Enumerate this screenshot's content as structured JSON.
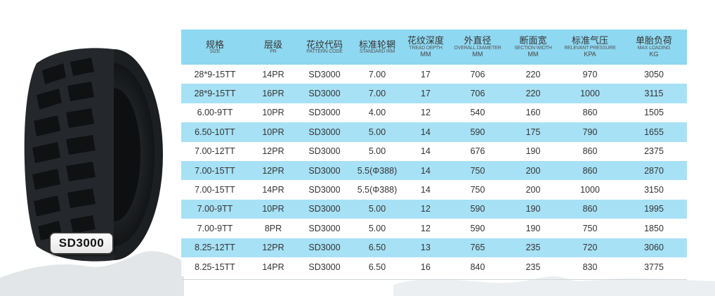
{
  "badge": "SD3000",
  "headers": [
    {
      "cn": "规格",
      "en": "SIZE",
      "unit": ""
    },
    {
      "cn": "层级",
      "en": "PR",
      "unit": ""
    },
    {
      "cn": "花纹代码",
      "en": "PATTERN CODE",
      "unit": ""
    },
    {
      "cn": "标准轮辋",
      "en": "STANDARD RIM",
      "unit": ""
    },
    {
      "cn": "花纹深度",
      "en": "TREAD DEPTH",
      "unit": "MM"
    },
    {
      "cn": "外直径",
      "en": "OVERALL DIAMETER",
      "unit": "MM"
    },
    {
      "cn": "断面宽",
      "en": "SECTION WIDTH",
      "unit": "MM"
    },
    {
      "cn": "标准气压",
      "en": "RELEVANT PRESSURE",
      "unit": "KPA"
    },
    {
      "cn": "单胎负荷",
      "en": "MAX LOADING",
      "unit": "KG"
    }
  ],
  "rows": [
    [
      "28*9-15TT",
      "14PR",
      "SD3000",
      "7.00",
      "17",
      "706",
      "220",
      "970",
      "3050"
    ],
    [
      "28*9-15TT",
      "16PR",
      "SD3000",
      "7.00",
      "17",
      "706",
      "220",
      "1000",
      "3115"
    ],
    [
      "6.00-9TT",
      "10PR",
      "SD3000",
      "4.00",
      "12",
      "540",
      "160",
      "860",
      "1505"
    ],
    [
      "6.50-10TT",
      "10PR",
      "SD3000",
      "5.00",
      "14",
      "590",
      "175",
      "790",
      "1655"
    ],
    [
      "7.00-12TT",
      "12PR",
      "SD3000",
      "5.00",
      "14",
      "676",
      "190",
      "860",
      "2375"
    ],
    [
      "7.00-15TT",
      "12PR",
      "SD3000",
      "5.5(Φ388)",
      "14",
      "750",
      "200",
      "860",
      "2870"
    ],
    [
      "7.00-15TT",
      "14PR",
      "SD3000",
      "5.5(Φ388)",
      "14",
      "750",
      "200",
      "1000",
      "3150"
    ],
    [
      "7.00-9TT",
      "10PR",
      "SD3000",
      "5.00",
      "12",
      "590",
      "190",
      "860",
      "1995"
    ],
    [
      "7.00-9TT",
      "8PR",
      "SD3000",
      "5.00",
      "12",
      "590",
      "190",
      "750",
      "1850"
    ],
    [
      "8.25-12TT",
      "12PR",
      "SD3000",
      "6.50",
      "13",
      "765",
      "235",
      "720",
      "3060"
    ],
    [
      "8.25-15TT",
      "14PR",
      "SD3000",
      "6.50",
      "16",
      "840",
      "235",
      "830",
      "3775"
    ]
  ],
  "colors": {
    "header_bg": "#8fd8f1",
    "alt_row_bg": "#a7e1f5",
    "text": "#333333"
  }
}
